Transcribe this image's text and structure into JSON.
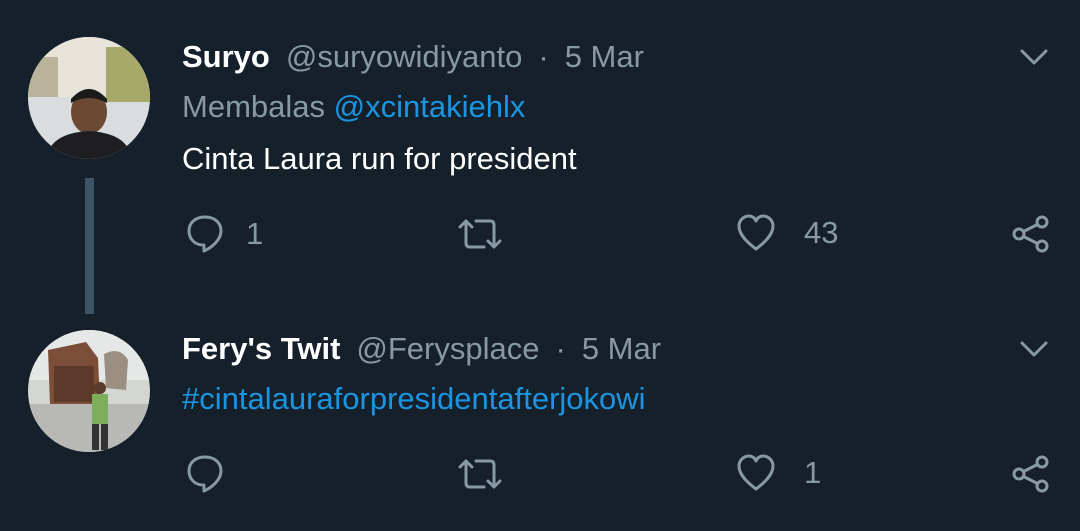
{
  "tweets": [
    {
      "name": "Suryo",
      "handle": "@suryowidiyanto",
      "separator": "·",
      "date": "5 Mar",
      "reply_prefix": "Membalas",
      "reply_to": "@xcintakiehlx",
      "text": "Cinta Laura run for president",
      "reply_count": "1",
      "retweet_count": "",
      "like_count": "43"
    },
    {
      "name": "Fery's Twit",
      "handle": "@Ferysplace",
      "separator": "·",
      "date": "5 Mar",
      "text": "#cintalauraforpresidentafterjokowi",
      "reply_count": "",
      "retweet_count": "",
      "like_count": "1"
    }
  ],
  "colors": {
    "background": "#15202b",
    "secondary_text": "#8899a6",
    "link": "#1b95e0",
    "thread_line": "#3d5466"
  },
  "icons": [
    "chevron-down-icon",
    "reply-icon",
    "retweet-icon",
    "like-icon",
    "share-icon"
  ]
}
